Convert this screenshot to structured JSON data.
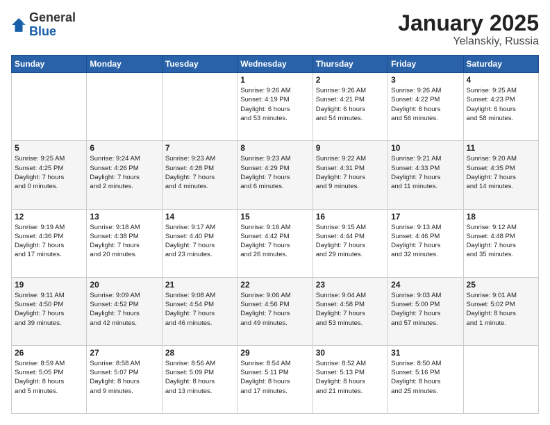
{
  "header": {
    "logo_general": "General",
    "logo_blue": "Blue",
    "title": "January 2025",
    "subtitle": "Yelanskiy, Russia"
  },
  "calendar": {
    "days_of_week": [
      "Sunday",
      "Monday",
      "Tuesday",
      "Wednesday",
      "Thursday",
      "Friday",
      "Saturday"
    ],
    "weeks": [
      [
        {
          "day": "",
          "info": ""
        },
        {
          "day": "",
          "info": ""
        },
        {
          "day": "",
          "info": ""
        },
        {
          "day": "1",
          "info": "Sunrise: 9:26 AM\nSunset: 4:19 PM\nDaylight: 6 hours\nand 53 minutes."
        },
        {
          "day": "2",
          "info": "Sunrise: 9:26 AM\nSunset: 4:21 PM\nDaylight: 6 hours\nand 54 minutes."
        },
        {
          "day": "3",
          "info": "Sunrise: 9:26 AM\nSunset: 4:22 PM\nDaylight: 6 hours\nand 56 minutes."
        },
        {
          "day": "4",
          "info": "Sunrise: 9:25 AM\nSunset: 4:23 PM\nDaylight: 6 hours\nand 58 minutes."
        }
      ],
      [
        {
          "day": "5",
          "info": "Sunrise: 9:25 AM\nSunset: 4:25 PM\nDaylight: 7 hours\nand 0 minutes."
        },
        {
          "day": "6",
          "info": "Sunrise: 9:24 AM\nSunset: 4:26 PM\nDaylight: 7 hours\nand 2 minutes."
        },
        {
          "day": "7",
          "info": "Sunrise: 9:23 AM\nSunset: 4:28 PM\nDaylight: 7 hours\nand 4 minutes."
        },
        {
          "day": "8",
          "info": "Sunrise: 9:23 AM\nSunset: 4:29 PM\nDaylight: 7 hours\nand 6 minutes."
        },
        {
          "day": "9",
          "info": "Sunrise: 9:22 AM\nSunset: 4:31 PM\nDaylight: 7 hours\nand 9 minutes."
        },
        {
          "day": "10",
          "info": "Sunrise: 9:21 AM\nSunset: 4:33 PM\nDaylight: 7 hours\nand 11 minutes."
        },
        {
          "day": "11",
          "info": "Sunrise: 9:20 AM\nSunset: 4:35 PM\nDaylight: 7 hours\nand 14 minutes."
        }
      ],
      [
        {
          "day": "12",
          "info": "Sunrise: 9:19 AM\nSunset: 4:36 PM\nDaylight: 7 hours\nand 17 minutes."
        },
        {
          "day": "13",
          "info": "Sunrise: 9:18 AM\nSunset: 4:38 PM\nDaylight: 7 hours\nand 20 minutes."
        },
        {
          "day": "14",
          "info": "Sunrise: 9:17 AM\nSunset: 4:40 PM\nDaylight: 7 hours\nand 23 minutes."
        },
        {
          "day": "15",
          "info": "Sunrise: 9:16 AM\nSunset: 4:42 PM\nDaylight: 7 hours\nand 26 minutes."
        },
        {
          "day": "16",
          "info": "Sunrise: 9:15 AM\nSunset: 4:44 PM\nDaylight: 7 hours\nand 29 minutes."
        },
        {
          "day": "17",
          "info": "Sunrise: 9:13 AM\nSunset: 4:46 PM\nDaylight: 7 hours\nand 32 minutes."
        },
        {
          "day": "18",
          "info": "Sunrise: 9:12 AM\nSunset: 4:48 PM\nDaylight: 7 hours\nand 35 minutes."
        }
      ],
      [
        {
          "day": "19",
          "info": "Sunrise: 9:11 AM\nSunset: 4:50 PM\nDaylight: 7 hours\nand 39 minutes."
        },
        {
          "day": "20",
          "info": "Sunrise: 9:09 AM\nSunset: 4:52 PM\nDaylight: 7 hours\nand 42 minutes."
        },
        {
          "day": "21",
          "info": "Sunrise: 9:08 AM\nSunset: 4:54 PM\nDaylight: 7 hours\nand 46 minutes."
        },
        {
          "day": "22",
          "info": "Sunrise: 9:06 AM\nSunset: 4:56 PM\nDaylight: 7 hours\nand 49 minutes."
        },
        {
          "day": "23",
          "info": "Sunrise: 9:04 AM\nSunset: 4:58 PM\nDaylight: 7 hours\nand 53 minutes."
        },
        {
          "day": "24",
          "info": "Sunrise: 9:03 AM\nSunset: 5:00 PM\nDaylight: 7 hours\nand 57 minutes."
        },
        {
          "day": "25",
          "info": "Sunrise: 9:01 AM\nSunset: 5:02 PM\nDaylight: 8 hours\nand 1 minute."
        }
      ],
      [
        {
          "day": "26",
          "info": "Sunrise: 8:59 AM\nSunset: 5:05 PM\nDaylight: 8 hours\nand 5 minutes."
        },
        {
          "day": "27",
          "info": "Sunrise: 8:58 AM\nSunset: 5:07 PM\nDaylight: 8 hours\nand 9 minutes."
        },
        {
          "day": "28",
          "info": "Sunrise: 8:56 AM\nSunset: 5:09 PM\nDaylight: 8 hours\nand 13 minutes."
        },
        {
          "day": "29",
          "info": "Sunrise: 8:54 AM\nSunset: 5:11 PM\nDaylight: 8 hours\nand 17 minutes."
        },
        {
          "day": "30",
          "info": "Sunrise: 8:52 AM\nSunset: 5:13 PM\nDaylight: 8 hours\nand 21 minutes."
        },
        {
          "day": "31",
          "info": "Sunrise: 8:50 AM\nSunset: 5:16 PM\nDaylight: 8 hours\nand 25 minutes."
        },
        {
          "day": "",
          "info": ""
        }
      ]
    ]
  }
}
